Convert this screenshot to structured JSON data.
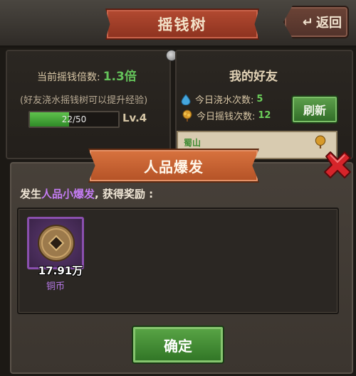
{
  "header": {
    "title": "摇钱树",
    "back_label": "返回"
  },
  "tree": {
    "rate_label": "当前摇钱倍数:",
    "rate_value": "1.3倍",
    "hint": "(好友浇水摇钱树可以提升经验)",
    "xp_text": "22/50",
    "xp_fraction": 0.44,
    "level": "Lv.4"
  },
  "friends": {
    "title": "我的好友",
    "water_label": "今日浇水次数:",
    "water_count": "5",
    "shake_label": "今日摇钱次数:",
    "shake_count": "12",
    "refresh_label": "刷新",
    "first_friend": "蜀山"
  },
  "popup": {
    "title": "人品爆发",
    "msg_prefix": "发生",
    "msg_highlight": "人品小爆发",
    "msg_suffix": ", 获得奖励 :",
    "reward_amount": "17.91万",
    "reward_name": "铜币",
    "confirm_label": "确定"
  },
  "colors": {
    "accent_green": "#64c25a",
    "highlight_purple": "#c47cf3",
    "banner_red": "#b24a31",
    "popup_banner_orange": "#d8733f"
  },
  "icons": [
    "return-arrow-icon",
    "water-drop-icon",
    "money-tree-icon",
    "close-x-icon",
    "copper-coin-icon"
  ]
}
